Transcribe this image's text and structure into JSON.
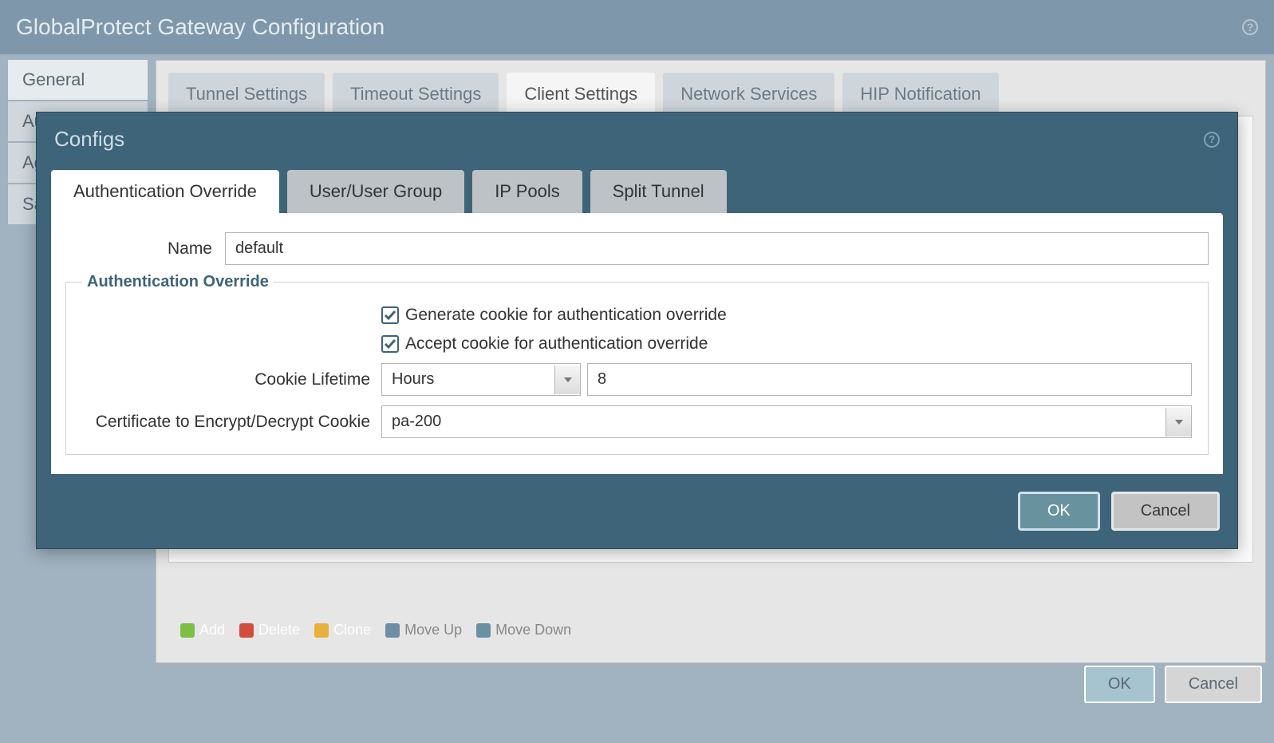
{
  "outer": {
    "title": "GlobalProtect Gateway Configuration",
    "sidebar": {
      "items": [
        {
          "label": "General"
        },
        {
          "label": "Authentication"
        },
        {
          "label": "Agent"
        },
        {
          "label": "Satellite"
        }
      ]
    },
    "topTabs": [
      {
        "label": "Tunnel Settings"
      },
      {
        "label": "Timeout Settings"
      },
      {
        "label": "Client Settings"
      },
      {
        "label": "Network Services"
      },
      {
        "label": "HIP Notification"
      }
    ],
    "actions": {
      "add": "Add",
      "delete": "Delete",
      "clone": "Clone",
      "moveUp": "Move Up",
      "moveDown": "Move Down"
    },
    "buttons": {
      "ok": "OK",
      "cancel": "Cancel"
    }
  },
  "configs": {
    "title": "Configs",
    "tabs": [
      {
        "label": "Authentication Override"
      },
      {
        "label": "User/User Group"
      },
      {
        "label": "IP Pools"
      },
      {
        "label": "Split Tunnel"
      }
    ],
    "form": {
      "nameLabel": "Name",
      "nameValue": "default",
      "fieldsetLegend": "Authentication Override",
      "generateCookieLabel": "Generate cookie for authentication override",
      "generateCookieChecked": true,
      "acceptCookieLabel": "Accept cookie for authentication override",
      "acceptCookieChecked": true,
      "cookieLifetimeLabel": "Cookie Lifetime",
      "cookieLifetimeUnit": "Hours",
      "cookieLifetimeValue": "8",
      "certLabel": "Certificate to Encrypt/Decrypt Cookie",
      "certValue": "pa-200"
    },
    "buttons": {
      "ok": "OK",
      "cancel": "Cancel"
    }
  }
}
